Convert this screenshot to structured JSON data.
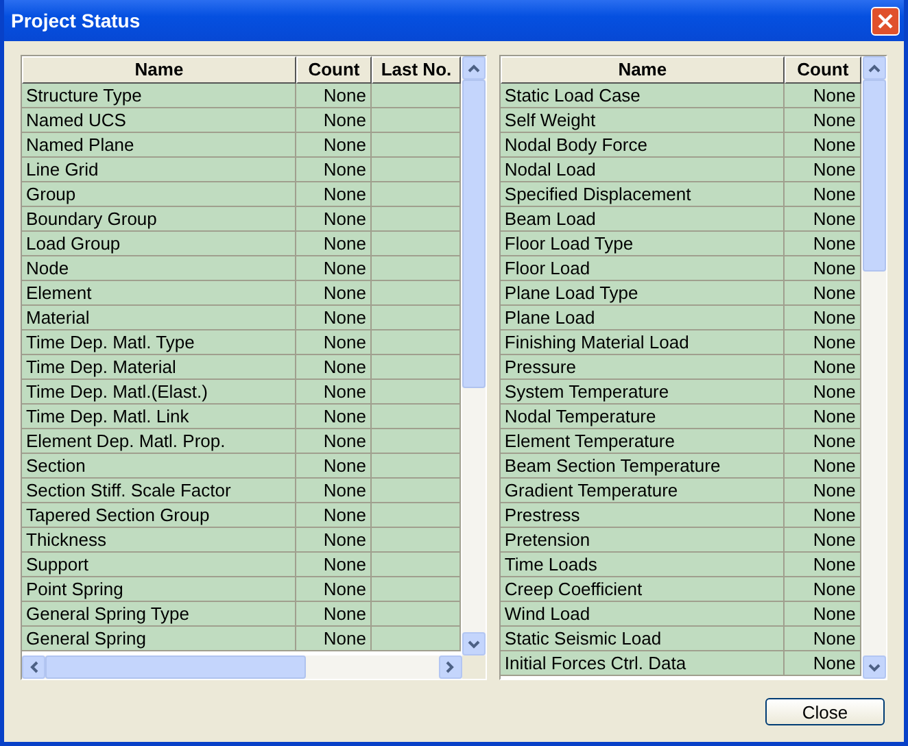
{
  "window": {
    "title": "Project Status"
  },
  "left_table": {
    "columns": [
      "Name",
      "Count",
      "Last No."
    ],
    "rows": [
      {
        "name": "Structure Type",
        "count": "None"
      },
      {
        "name": "Named UCS",
        "count": "None"
      },
      {
        "name": "Named Plane",
        "count": "None"
      },
      {
        "name": "Line Grid",
        "count": "None"
      },
      {
        "name": "Group",
        "count": "None"
      },
      {
        "name": "Boundary Group",
        "count": "None"
      },
      {
        "name": "Load Group",
        "count": "None"
      },
      {
        "name": "Node",
        "count": "None"
      },
      {
        "name": "Element",
        "count": "None"
      },
      {
        "name": "Material",
        "count": "None"
      },
      {
        "name": "Time Dep. Matl. Type",
        "count": "None"
      },
      {
        "name": "Time Dep. Material",
        "count": "None"
      },
      {
        "name": "Time Dep. Matl.(Elast.)",
        "count": "None"
      },
      {
        "name": "Time Dep. Matl. Link",
        "count": "None"
      },
      {
        "name": "Element Dep. Matl. Prop.",
        "count": "None"
      },
      {
        "name": "Section",
        "count": "None"
      },
      {
        "name": "Section Stiff. Scale Factor",
        "count": "None"
      },
      {
        "name": "Tapered Section Group",
        "count": "None"
      },
      {
        "name": "Thickness",
        "count": "None"
      },
      {
        "name": "Support",
        "count": "None"
      },
      {
        "name": "Point Spring",
        "count": "None"
      },
      {
        "name": "General Spring Type",
        "count": "None"
      },
      {
        "name": "General Spring",
        "count": "None"
      }
    ]
  },
  "right_table": {
    "columns": [
      "Name",
      "Count"
    ],
    "rows": [
      {
        "name": "Static Load Case",
        "count": "None"
      },
      {
        "name": "Self Weight",
        "count": "None"
      },
      {
        "name": "Nodal Body Force",
        "count": "None"
      },
      {
        "name": "Nodal Load",
        "count": "None"
      },
      {
        "name": "Specified Displacement",
        "count": "None"
      },
      {
        "name": "Beam Load",
        "count": "None"
      },
      {
        "name": "Floor Load Type",
        "count": "None"
      },
      {
        "name": "Floor Load",
        "count": "None"
      },
      {
        "name": "Plane Load Type",
        "count": "None"
      },
      {
        "name": "Plane Load",
        "count": "None"
      },
      {
        "name": "Finishing Material Load",
        "count": "None"
      },
      {
        "name": "Pressure",
        "count": "None"
      },
      {
        "name": "System Temperature",
        "count": "None"
      },
      {
        "name": "Nodal Temperature",
        "count": "None"
      },
      {
        "name": "Element Temperature",
        "count": "None"
      },
      {
        "name": "Beam Section Temperature",
        "count": "None"
      },
      {
        "name": "Gradient Temperature",
        "count": "None"
      },
      {
        "name": "Prestress",
        "count": "None"
      },
      {
        "name": "Pretension",
        "count": "None"
      },
      {
        "name": "Time Loads",
        "count": "None"
      },
      {
        "name": "Creep Coefficient",
        "count": "None"
      },
      {
        "name": "Wind Load",
        "count": "None"
      },
      {
        "name": "Static Seismic Load",
        "count": "None"
      },
      {
        "name": "Initial Forces Ctrl. Data",
        "count": "None"
      }
    ]
  },
  "buttons": [
    "Close"
  ]
}
